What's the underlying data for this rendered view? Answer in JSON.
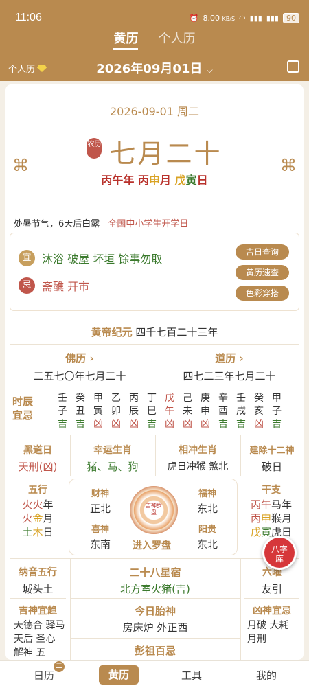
{
  "status": {
    "time": "11:06",
    "net_speed": "8.00",
    "net_unit": "KB/S",
    "battery": "90"
  },
  "tabs": [
    {
      "label": "黄历"
    },
    {
      "label": "个人历"
    }
  ],
  "datebar": {
    "personal": "个人历",
    "date": "2026年09月01日"
  },
  "card": {
    "gregorian": "2026-09-01 周二",
    "lunar_tag": "农历",
    "lunar_date": "七月二十",
    "ganzhi": {
      "y1": "丙午",
      "yu": "年",
      "m1": "丙",
      "m2": "申",
      "mu": "月",
      "d1": "戊",
      "d2": "寅",
      "du": "日"
    },
    "term": "处暑节气，6天后白露",
    "holiday": "全国中小学生开学日"
  },
  "yiji": {
    "yi_icon": "宜",
    "yi": "沐浴 破屋 坏垣 馀事勿取",
    "ji_icon": "忌",
    "ji": "斋醮 开市",
    "buttons": [
      "吉日查询",
      "黄历速查",
      "色彩穿搭"
    ]
  },
  "era": {
    "label": "黄帝纪元",
    "value": "四千七百二十三年"
  },
  "buddhist": {
    "title": "佛历",
    "value": "二五七〇年七月二十"
  },
  "taoist": {
    "title": "道历",
    "value": "四七二三年七月二十"
  },
  "shichen": {
    "label1": "时辰",
    "label2": "宜忌",
    "columns": [
      {
        "gan": "壬",
        "zhi": "子",
        "luck": "吉"
      },
      {
        "gan": "癸",
        "zhi": "丑",
        "luck": "吉"
      },
      {
        "gan": "甲",
        "zhi": "寅",
        "luck": "凶"
      },
      {
        "gan": "乙",
        "zhi": "卯",
        "luck": "凶"
      },
      {
        "gan": "丙",
        "zhi": "辰",
        "luck": "凶"
      },
      {
        "gan": "丁",
        "zhi": "巳",
        "luck": "吉"
      },
      {
        "gan": "戊",
        "zhi": "午",
        "luck": "凶"
      },
      {
        "gan": "己",
        "zhi": "未",
        "luck": "凶"
      },
      {
        "gan": "庚",
        "zhi": "申",
        "luck": "凶"
      },
      {
        "gan": "辛",
        "zhi": "酉",
        "luck": "吉"
      },
      {
        "gan": "壬",
        "zhi": "戌",
        "luck": "吉"
      },
      {
        "gan": "癸",
        "zhi": "亥",
        "luck": "凶"
      },
      {
        "gan": "甲",
        "zhi": "子",
        "luck": "吉"
      }
    ]
  },
  "grid": {
    "heidao": {
      "title": "黑道日",
      "value": "天刑(凶)"
    },
    "lucky_zodiac": {
      "title": "幸运生肖",
      "value": "猪、马、狗"
    },
    "clash": {
      "title": "相冲生肖",
      "value": "虎日冲猴  煞北"
    },
    "jianchu": {
      "title": "建除十二神",
      "value": "破日"
    },
    "wuxing": {
      "title": "五行",
      "l1a": "火火",
      "l1b": "年",
      "l2a": "火",
      "l2b": "金",
      "l2c": "月",
      "l3a": "土",
      "l3b": "木",
      "l3c": "日"
    },
    "ganzhi": {
      "title": "干支",
      "r1a": "丙",
      "r1b": "午",
      "r1c": "马年",
      "r2a": "丙",
      "r2b": "申",
      "r2c": "猴月",
      "r3a": "戊",
      "r3b": "寅",
      "r3c": "虎日"
    },
    "compass": {
      "center": "吉神罗盘",
      "caishen": "财神",
      "caishen_dir": "正北",
      "fushen": "福神",
      "fushen_dir": "东北",
      "xishen": "喜神",
      "xishen_dir": "东南",
      "yanggui": "阳贵",
      "yanggui_dir": "东北",
      "enter": "进入罗盘"
    },
    "nayin": {
      "title": "纳音五行",
      "value": "城头土"
    },
    "xiu": {
      "title": "二十八星宿",
      "value": "北方室火猪(吉)"
    },
    "liuyao": {
      "title": "六曜",
      "value": "友引"
    },
    "jishen": {
      "title": "吉神宜趋",
      "value": "天德合 驿马 天后 圣心 解神 五"
    },
    "taishen": {
      "title": "今日胎神",
      "value": "房床炉 外正西"
    },
    "pengzu": {
      "title": "彭祖百忌"
    },
    "xiongshen": {
      "title": "凶神宜忌",
      "value": "月破 大耗 月刑"
    }
  },
  "float_button": {
    "l1": "八字",
    "l2": "库"
  },
  "nav": {
    "items": [
      "日历",
      "黄历",
      "工具",
      "我的"
    ],
    "badge": "二"
  }
}
